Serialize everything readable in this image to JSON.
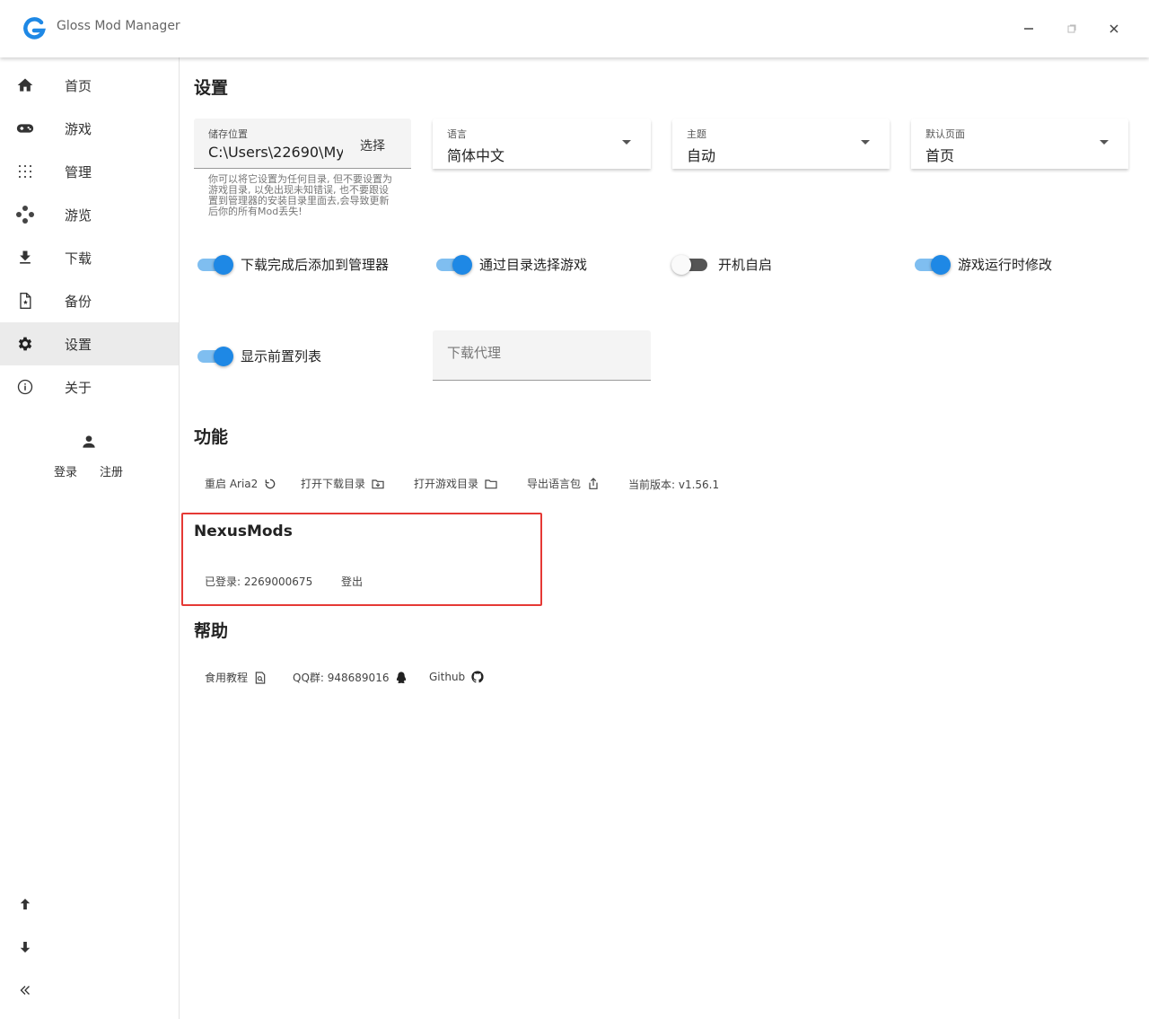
{
  "app": {
    "title": "Gloss Mod Manager",
    "brand_color": "#1e88e5"
  },
  "window_controls": {
    "minimize_icon": "minus-icon",
    "maximize_icon": "restore-icon",
    "close_icon": "close-icon"
  },
  "sidebar": {
    "items": [
      {
        "label": "首页",
        "icon": "home-icon"
      },
      {
        "label": "游戏",
        "icon": "gamepad-icon"
      },
      {
        "label": "管理",
        "icon": "grid-icon"
      },
      {
        "label": "游览",
        "icon": "dots-icon"
      },
      {
        "label": "下载",
        "icon": "download-icon"
      },
      {
        "label": "备份",
        "icon": "backup-file-icon"
      },
      {
        "label": "设置",
        "icon": "gear-icon"
      },
      {
        "label": "关于",
        "icon": "info-icon"
      }
    ],
    "active_index": 6,
    "login": "登录",
    "register": "注册",
    "bottom": [
      "arrow-up-icon",
      "arrow-down-icon",
      "collapse-icon"
    ]
  },
  "settings": {
    "title": "设置",
    "storage": {
      "label": "储存位置",
      "value": "C:\\Users\\22690\\My",
      "button": "选择",
      "hint": "你可以将它设置为任何目录, 但不要设置为游戏目录, 以免出现未知错误, 也不要跟设置到管理器的安装目录里面去,会导致更新后你的所有Mod丢失!"
    },
    "language": {
      "label": "语言",
      "value": "简体中文"
    },
    "theme": {
      "label": "主题",
      "value": "自动"
    },
    "default_page": {
      "label": "默认页面",
      "value": "首页"
    },
    "switches": [
      {
        "label": "下载完成后添加到管理器",
        "on": true
      },
      {
        "label": "通过目录选择游戏",
        "on": true
      },
      {
        "label": "开机自启",
        "on": false
      },
      {
        "label": "游戏运行时修改",
        "on": true
      },
      {
        "label": "显示前置列表",
        "on": true
      }
    ],
    "proxy": {
      "placeholder": "下载代理",
      "value": ""
    }
  },
  "features": {
    "title": "功能",
    "restart_aria2": "重启 Aria2",
    "open_download_dir": "打开下载目录",
    "open_game_dir": "打开游戏目录",
    "export_language": "导出语言包",
    "version": "当前版本: v1.56.1"
  },
  "nexus": {
    "title": "NexusMods",
    "logged_in": "已登录: 2269000675",
    "logout": "登出",
    "highlight_color": "#e53935"
  },
  "help": {
    "title": "帮助",
    "tutorial": "食用教程",
    "qq_group": "QQ群: 948689016",
    "github": "Github"
  }
}
